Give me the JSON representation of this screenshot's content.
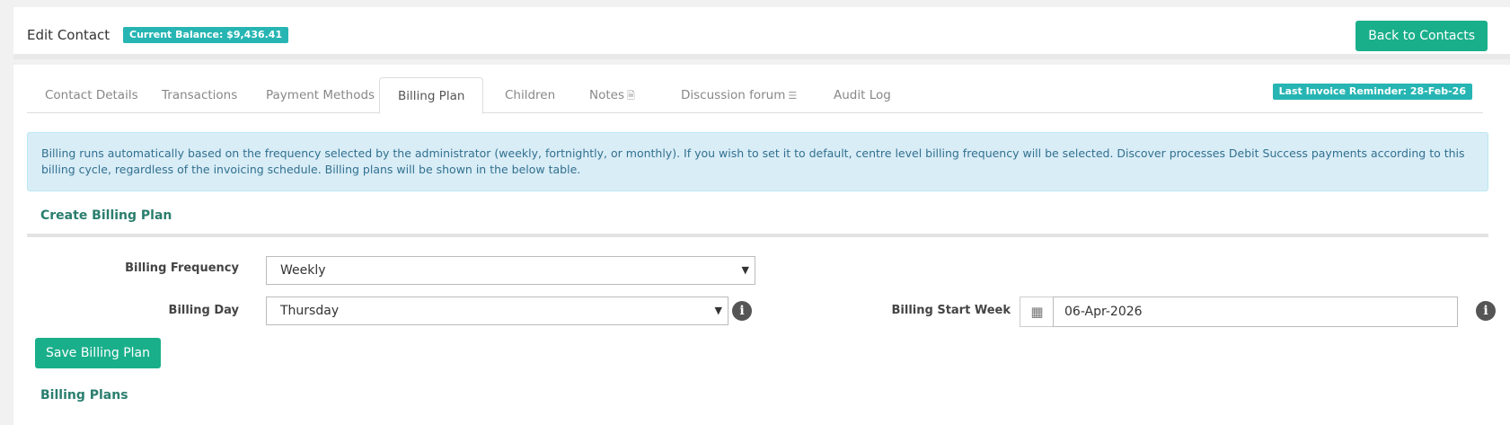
{
  "header": {
    "title": "Edit Contact",
    "balance_badge": "Current Balance: $9,436.41",
    "back_button": "Back to Contacts"
  },
  "tabs": [
    {
      "label": "Contact Details",
      "icon": ""
    },
    {
      "label": "Transactions",
      "icon": ""
    },
    {
      "label": "Payment Methods",
      "icon": ""
    },
    {
      "label": "Billing Plan",
      "icon": "",
      "active": true
    },
    {
      "label": "Children",
      "icon": ""
    },
    {
      "label": "Notes",
      "icon": "document-icon"
    },
    {
      "label": "Discussion forum",
      "icon": "forum-icon"
    },
    {
      "label": "Audit Log",
      "icon": ""
    }
  ],
  "reminder_badge": "Last Invoice Reminder: 28-Feb-26",
  "info_alert": "Billing runs automatically based on the frequency selected by the administrator (weekly, fortnightly, or monthly). If you wish to set it to default, centre level billing frequency will be selected. Discover processes Debit Success payments according to this billing cycle, regardless of the invoicing schedule. Billing plans will be shown in the below table.",
  "form": {
    "section_title": "Create Billing Plan",
    "frequency_label": "Billing Frequency",
    "frequency_value": "Weekly",
    "day_label": "Billing Day",
    "day_value": "Thursday",
    "start_week_label": "Billing Start Week",
    "start_week_value": "06-Apr-2026",
    "save_button": "Save Billing Plan"
  },
  "plans_title": "Billing Plans",
  "colors": {
    "accent": "#1aaf8b",
    "badge": "#26b5b3",
    "section_title": "#2a7e6e",
    "alert_bg": "#d9edf7"
  }
}
